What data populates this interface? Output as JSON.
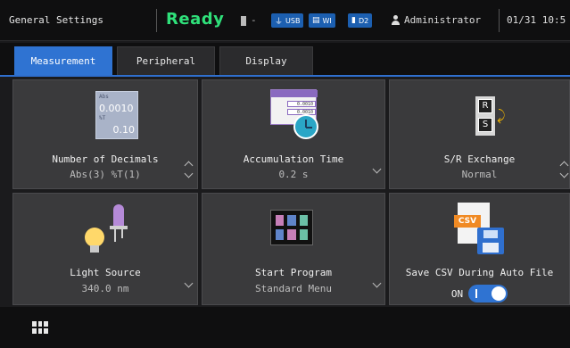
{
  "header": {
    "title": "General Settings",
    "status": "Ready",
    "battery_text": "-",
    "badges": [
      {
        "icon": "usb-icon",
        "label": "USB"
      },
      {
        "icon": "wi-icon",
        "label": "WI"
      },
      {
        "icon": "d2-icon",
        "label": "D2"
      }
    ],
    "user": "Administrator",
    "datetime": "01/31 10:5"
  },
  "tabs": [
    {
      "label": "Measurement",
      "active": true
    },
    {
      "label": "Peripheral",
      "active": false
    },
    {
      "label": "Display",
      "active": false
    }
  ],
  "tiles": {
    "decimals": {
      "label": "Number of Decimals",
      "value": "Abs(3) %T(1)",
      "icon_text": {
        "t1": "Abs",
        "n1": "0.0010",
        "t2": "%T",
        "n2": "0.10"
      }
    },
    "accumulation": {
      "label": "Accumulation Time",
      "value": "0.2 s",
      "icon_rows": [
        "0.0010",
        "0.0010"
      ]
    },
    "sr_exchange": {
      "label": "S/R Exchange",
      "value": "Normal",
      "icon_letters": [
        "R",
        "S"
      ]
    },
    "light_source": {
      "label": "Light Source",
      "value": "340.0 nm"
    },
    "start_program": {
      "label": "Start Program",
      "value": "Standard Menu"
    },
    "save_csv": {
      "label": "Save CSV During Auto File",
      "toggle_label": "ON",
      "toggle_on": true,
      "icon_text": "CSV"
    }
  },
  "colors": {
    "accent": "#2f73d2",
    "ready": "#2fe07a",
    "tile_bg": "#3a3a3c"
  }
}
